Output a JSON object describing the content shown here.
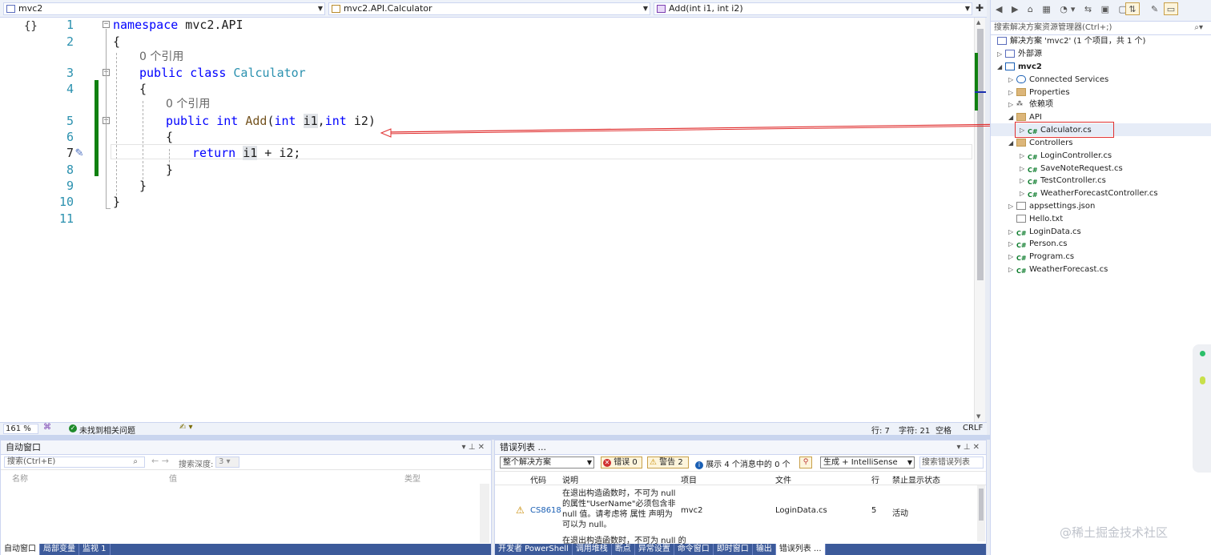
{
  "editor_nav": {
    "project": "mvc2",
    "class": "mvc2.API.Calculator",
    "member": "Add(int i1, int i2)"
  },
  "code": {
    "line_numbers": [
      "1",
      "2",
      "3",
      "4",
      "5",
      "6",
      "7",
      "8",
      "9",
      "10",
      "11"
    ],
    "namespace_kw": "namespace",
    "namespace_name": " mvc2.API",
    "brace_open": "{",
    "brace_close": "}",
    "ref_hint": "0 个引用",
    "public_kw": "public",
    "class_kw": "class",
    "class_name": "Calculator",
    "int_kw": "int",
    "method_name": "Add",
    "param1": "i1",
    "param2": "i2",
    "return_kw": "return",
    "expr_a": "i1",
    "expr_rest": " + i2;"
  },
  "editor_status": {
    "zoom": "161 %",
    "issues": "未找到相关问题",
    "line": "行: 7",
    "col": "字符: 21",
    "spaces": "空格",
    "eol": "CRLF"
  },
  "autos": {
    "title": "自动窗口",
    "search_placeholder": "搜索(Ctrl+E)",
    "depth_label": "搜索深度:",
    "depth_value": "3",
    "columns": [
      "名称",
      "值",
      "类型"
    ],
    "tabs": [
      "自动窗口",
      "局部变量",
      "监视 1"
    ]
  },
  "errors": {
    "title": "错误列表 ...",
    "scope": "整个解决方案",
    "errors_btn": "错误 0",
    "warnings_btn": "警告 2",
    "messages_btn": "展示 4 个消息中的 0 个",
    "build_filter": "生成 + IntelliSense",
    "search_placeholder": "搜索错误列表",
    "columns": [
      "代码",
      "说明",
      "项目",
      "文件",
      "行",
      "禁止显示状态"
    ],
    "row1": {
      "code": "CS8618",
      "desc": "在退出构造函数时，不可为 null 的属性\"UserName\"必须包含非 null 值。请考虑将 属性 声明为可以为 null。",
      "project": "mvc2",
      "file": "LoginData.cs",
      "line": "5",
      "state": "活动"
    },
    "row2_desc": "在退出构造函数时，不可为 null 的",
    "tabs": [
      "开发者 PowerShell",
      "调用堆栈",
      "断点",
      "异常设置",
      "命令窗口",
      "即时窗口",
      "输出",
      "错误列表 ..."
    ]
  },
  "solution_explorer": {
    "search_placeholder": "搜索解决方案资源管理器(Ctrl+;)",
    "solution": "解决方案 'mvc2' (1 个项目，共 1 个)",
    "external": "外部源",
    "project": "mvc2",
    "items": {
      "connected": "Connected Services",
      "properties": "Properties",
      "deps": "依赖项",
      "api": "API",
      "calculator": "Calculator.cs",
      "controllers": "Controllers",
      "login_ctrl": "LoginController.cs",
      "savenote": "SaveNoteRequest.cs",
      "test_ctrl": "TestController.cs",
      "weather_ctrl": "WeatherForecastController.cs",
      "appsettings": "appsettings.json",
      "hello": "Hello.txt",
      "logindata": "LoginData.cs",
      "person": "Person.cs",
      "program": "Program.cs",
      "weather": "WeatherForecast.cs"
    }
  },
  "watermark": "@稀土掘金技术社区",
  "colors": {
    "accent": "#3c5a9a",
    "keyword": "#0000ff",
    "type": "#2b91af",
    "annotation_red": "#e03030",
    "change_bar": "#108010"
  }
}
